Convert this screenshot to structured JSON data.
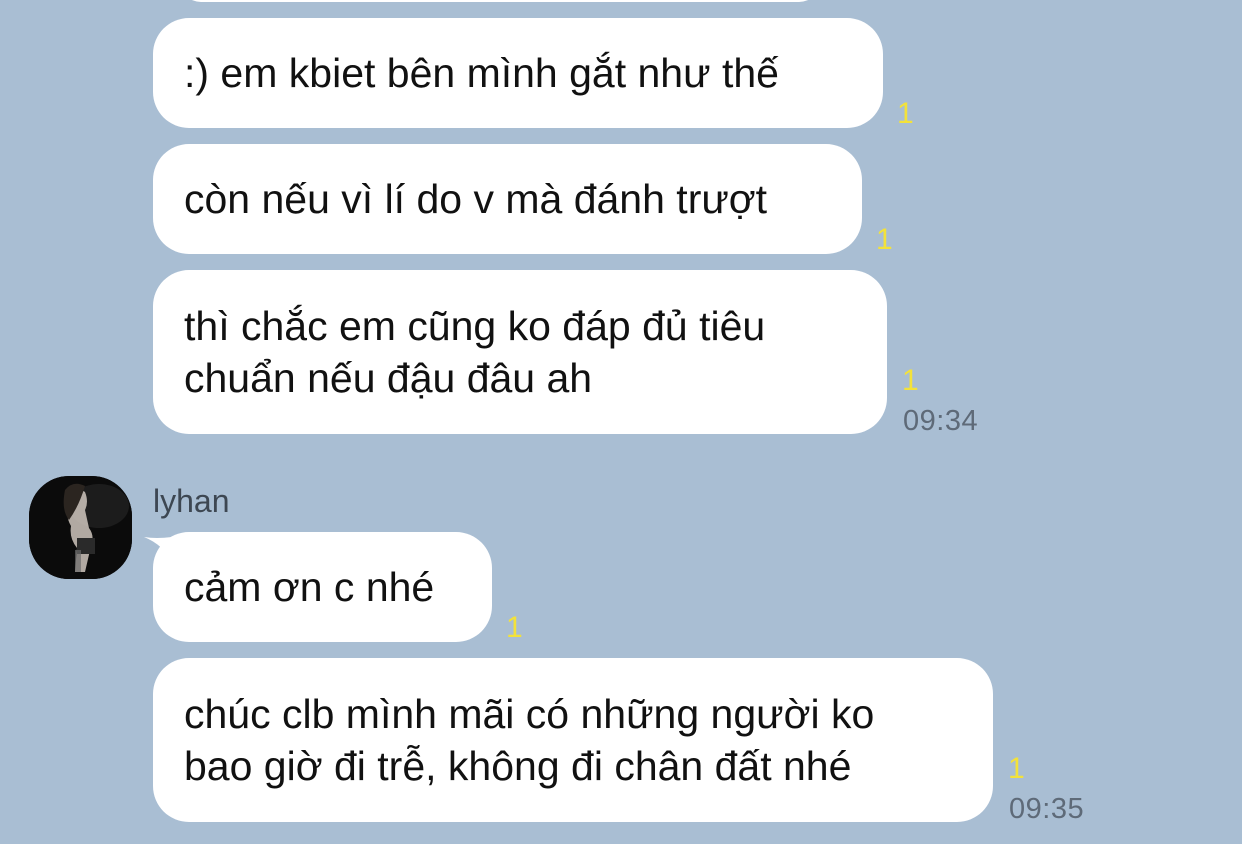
{
  "messages": [
    {
      "text": ":) em kbiet bên mình gắt như thế",
      "read": "1"
    },
    {
      "text": "còn nếu vì lí do v mà đánh trượt",
      "read": "1"
    },
    {
      "lines": [
        "thì chắc em cũng ko đáp đủ tiêu",
        "chuẩn nếu đậu đâu ah"
      ],
      "read": "1",
      "time": "09:34"
    },
    {
      "text": "cảm ơn c nhé",
      "read": "1"
    },
    {
      "lines": [
        "chúc clb mình mãi có những người ko",
        "bao giờ đi trễ, không đi chân đất nhé"
      ],
      "read": "1",
      "time": "09:35"
    }
  ],
  "sender": {
    "name": "lyhan"
  },
  "colors": {
    "background": "#a9bed3",
    "bubble": "#ffffff",
    "read_indicator": "#f3e23a",
    "timestamp": "#5e6a78"
  }
}
